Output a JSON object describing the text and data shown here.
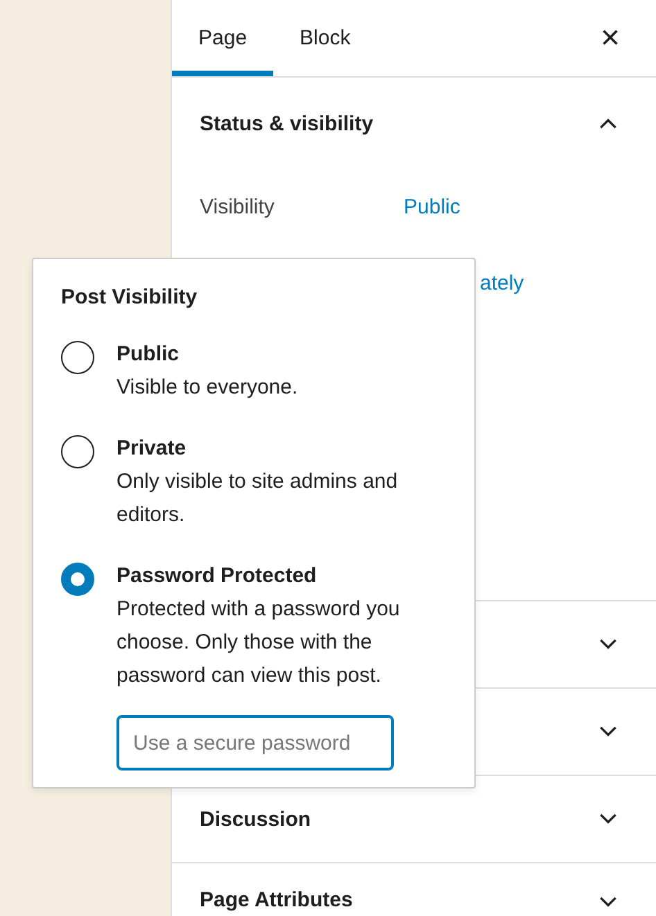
{
  "tabs": [
    {
      "label": "Page",
      "selected": true
    },
    {
      "label": "Block",
      "selected": false
    }
  ],
  "close": {
    "icon": "×"
  },
  "status_panel": {
    "title": "Status & visibility",
    "expanded": true,
    "rows": [
      {
        "label": "Visibility",
        "value": "Public"
      },
      {
        "value": "ately"
      }
    ]
  },
  "panels": [
    {
      "expanded": false
    },
    {
      "expanded": false
    },
    {
      "title": "Discussion",
      "expanded": false
    },
    {
      "title": "Page Attributes",
      "expanded": false
    }
  ],
  "popover": {
    "title": "Post Visibility",
    "options": [
      {
        "label": "Public",
        "description": "Visible to everyone.",
        "selected": false
      },
      {
        "label": "Private",
        "description": "Only visible to site admins and editors.",
        "selected": false
      },
      {
        "label": "Password Protected",
        "description": "Protected with a password you choose. Only those with the password can view this post.",
        "selected": true
      }
    ],
    "password": {
      "placeholder": "Use a secure password"
    }
  }
}
